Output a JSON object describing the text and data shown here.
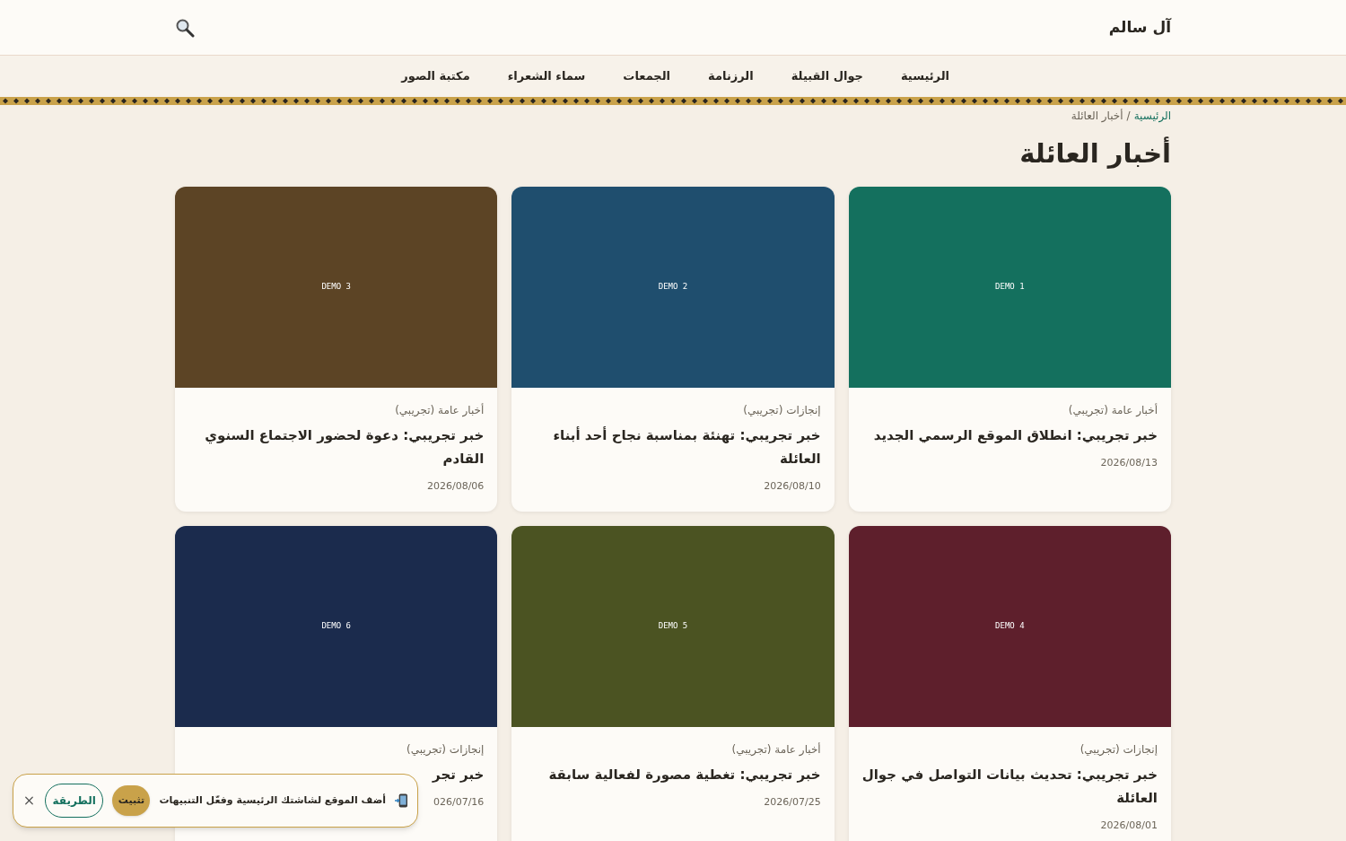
{
  "site": {
    "title": "آل سالم"
  },
  "nav": [
    {
      "label": "الرئيسية"
    },
    {
      "label": "جوال القبيلة"
    },
    {
      "label": "الرزنامة"
    },
    {
      "label": "الجمعات"
    },
    {
      "label": "سماء الشعراء"
    },
    {
      "label": "مكتبة الصور"
    }
  ],
  "breadcrumb": {
    "home": "الرئيسية",
    "separator": "/",
    "current": "أخبار العائلة"
  },
  "page_title": "أخبار العائلة",
  "cards": [
    {
      "image_label": "DEMO 1",
      "color": "#14705e",
      "category": "أخبار عامة (تجريبي)",
      "title": "خبر تجريبي: انطلاق الموقع الرسمي الجديد",
      "date": "2026/08/13"
    },
    {
      "image_label": "DEMO 2",
      "color": "#1f4e6e",
      "category": "إنجازات (تجريبي)",
      "title": "خبر تجريبي: تهنئة بمناسبة نجاح أحد أبناء العائلة",
      "date": "2026/08/10"
    },
    {
      "image_label": "DEMO 3",
      "color": "#5c4425",
      "category": "أخبار عامة (تجريبي)",
      "title": "خبر تجريبي: دعوة لحضور الاجتماع السنوي القادم",
      "date": "2026/08/06"
    },
    {
      "image_label": "DEMO 4",
      "color": "#5e1f2c",
      "category": "إنجازات (تجريبي)",
      "title": "خبر تجريبي: تحديث بيانات التواصل في جوال العائلة",
      "date": "2026/08/01"
    },
    {
      "image_label": "DEMO 5",
      "color": "#4b5322",
      "category": "أخبار عامة (تجريبي)",
      "title": "خبر تجريبي: تغطية مصورة لفعالية سابقة",
      "date": "2026/07/25"
    },
    {
      "image_label": "DEMO 6",
      "color": "#1b2b4d",
      "category": "إنجازات (تجريبي)",
      "title": "خبر تجر",
      "date": "026/07/16"
    }
  ],
  "install_banner": {
    "message": "أضف الموقع لشاشتك الرئيسية وفعّل التنبيهات",
    "install_button": "تثبيت",
    "howto_button": "الطريقة"
  }
}
